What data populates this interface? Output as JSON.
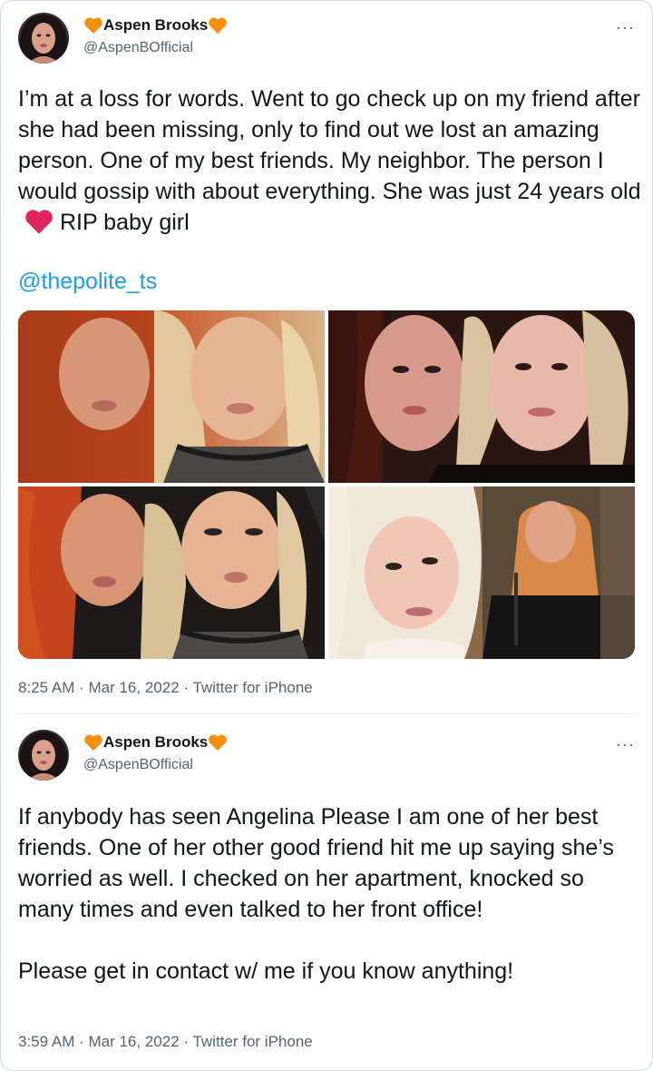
{
  "tweets": [
    {
      "author_name": "Aspen Brooks",
      "handle": "@AspenBOfficial",
      "more_label": "···",
      "text_before_heart": "I’m at a loss for words. Went to go check up on my friend after she had been missing, only to find out we lost an amazing person. One of my best friends. My neighbor. The person I would gossip with about everything. She was just 24 years old",
      "text_after_heart": "RIP baby girl",
      "mention": "@thepolite_ts",
      "timestamp": "8:25 AM · Mar 16, 2022 · Twitter for iPhone",
      "photos": [
        "photo-1",
        "photo-2",
        "photo-3",
        "photo-4"
      ]
    },
    {
      "author_name": "Aspen Brooks",
      "handle": "@AspenBOfficial",
      "more_label": "···",
      "text": "If anybody has seen Angelina Please I am one of her best friends. One of her other good friend hit me up saying she’s worried as well. I checked on her apartment, knocked so many times and even talked to her front office!\n\nPlease get in contact w/ me if you know anything!",
      "timestamp": "3:59 AM · Mar 16, 2022 · Twitter for iPhone"
    }
  ],
  "colors": {
    "link": "#1d9bf0",
    "secondary_text": "#536471",
    "heart_red": "#e0245e",
    "heart_orange": "#f4900c"
  },
  "icons": [
    "orange-heart-icon",
    "red-heart-icon",
    "more-options-icon"
  ]
}
